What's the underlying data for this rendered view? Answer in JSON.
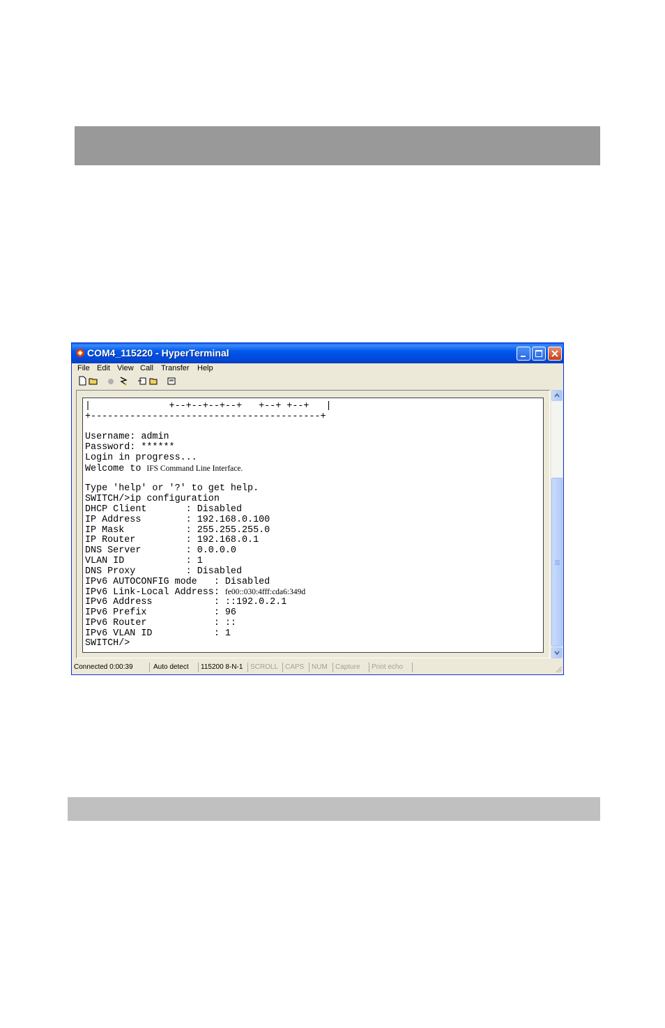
{
  "window": {
    "title": "COM4_115220 - HyperTerminal"
  },
  "menu": [
    "File",
    "Edit",
    "View",
    "Call",
    "Transfer",
    "Help"
  ],
  "toolbar_icons": [
    "new-icon",
    "open-icon",
    "connect-icon",
    "disconnect-icon",
    "send-icon",
    "receive-icon",
    "properties-icon"
  ],
  "terminal": {
    "line_01": "|              +--+--+--+--+   +--+ +--+   |",
    "line_02": "+-----------------------------------------+",
    "line_03": "",
    "line_04": "Username: admin",
    "line_05": "Password: ******",
    "line_06": "Login in progress...",
    "line_07_prefix": "Welcome to ",
    "line_07_rest": "IFS Command Line Interface.",
    "line_08": "",
    "line_09": "Type 'help' or '?' to get help.",
    "line_10": "SWITCH/>ip configuration",
    "line_11": "DHCP Client       : Disabled",
    "line_12": "IP Address        : 192.168.0.100",
    "line_13": "IP Mask           : 255.255.255.0",
    "line_14": "IP Router         : 192.168.0.1",
    "line_15": "DNS Server        : 0.0.0.0",
    "line_16": "VLAN ID           : 1",
    "line_17": "DNS Proxy         : Disabled",
    "line_18": "IPv6 AUTOCONFIG mode   : Disabled",
    "line_19_prefix": "IPv6 Link-Local Address: ",
    "line_19_rest": "fe00::030:4fff:cda6:349d",
    "line_20": "IPv6 Address           : ::192.0.2.1",
    "line_21": "IPv6 Prefix            : 96",
    "line_22": "IPv6 Router            : ::",
    "line_23": "IPv6 VLAN ID           : 1",
    "line_24": "SWITCH/>"
  },
  "status": {
    "connected": "Connected 0:00:39",
    "detect": "Auto detect",
    "settings": "115200 8-N-1",
    "scroll": "SCROLL",
    "caps": "CAPS",
    "num": "NUM",
    "capture": "Capture",
    "print_echo": "Print echo"
  }
}
